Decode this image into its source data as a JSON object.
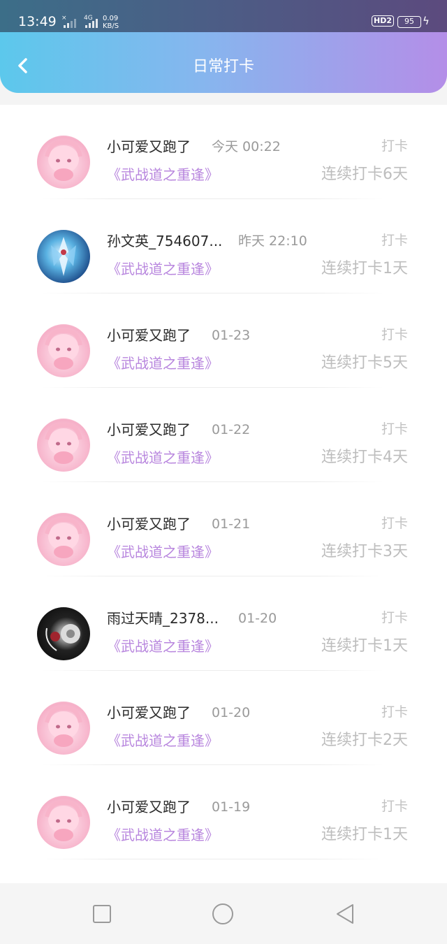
{
  "status_bar": {
    "time": "13:49",
    "sim1_label": "×",
    "sim2_label": "4G",
    "net_speed_line1": "0.09",
    "net_speed_line2": "KB/S",
    "hd_label": "HD2",
    "battery": "95"
  },
  "header": {
    "title": "日常打卡",
    "back_icon": "chevron-left-icon"
  },
  "entries": [
    {
      "name": "小可爱又跑了",
      "time": "今天 00:22",
      "book": "《武战道之重逢》",
      "action": "打卡",
      "streak": "连续打卡6天",
      "avatar": "pink-anime-avatar"
    },
    {
      "name": "孙文英_754607...",
      "time": "昨天 22:10",
      "book": "《武战道之重逢》",
      "action": "打卡",
      "streak": "连续打卡1天",
      "avatar": "blue-mecha-avatar"
    },
    {
      "name": "小可爱又跑了",
      "time": "01-23",
      "book": "《武战道之重逢》",
      "action": "打卡",
      "streak": "连续打卡5天",
      "avatar": "pink-anime-avatar"
    },
    {
      "name": "小可爱又跑了",
      "time": "01-22",
      "book": "《武战道之重逢》",
      "action": "打卡",
      "streak": "连续打卡4天",
      "avatar": "pink-anime-avatar"
    },
    {
      "name": "小可爱又跑了",
      "time": "01-21",
      "book": "《武战道之重逢》",
      "action": "打卡",
      "streak": "连续打卡3天",
      "avatar": "pink-anime-avatar"
    },
    {
      "name": "雨过天晴_2378...",
      "time": "01-20",
      "book": "《武战道之重逢》",
      "action": "打卡",
      "streak": "连续打卡1天",
      "avatar": "dark-flower-avatar"
    },
    {
      "name": "小可爱又跑了",
      "time": "01-20",
      "book": "《武战道之重逢》",
      "action": "打卡",
      "streak": "连续打卡2天",
      "avatar": "pink-anime-avatar"
    },
    {
      "name": "小可爱又跑了",
      "time": "01-19",
      "book": "《武战道之重逢》",
      "action": "打卡",
      "streak": "连续打卡1天",
      "avatar": "pink-anime-avatar"
    }
  ],
  "nav_bar": {
    "recent_icon": "square-icon",
    "home_icon": "circle-icon",
    "back_icon": "triangle-back-icon"
  },
  "colors": {
    "header_gradient_start": "#5cc8ec",
    "header_gradient_end": "#b48ee8",
    "book_title": "#b886de",
    "muted_text": "#9a9a9a"
  }
}
